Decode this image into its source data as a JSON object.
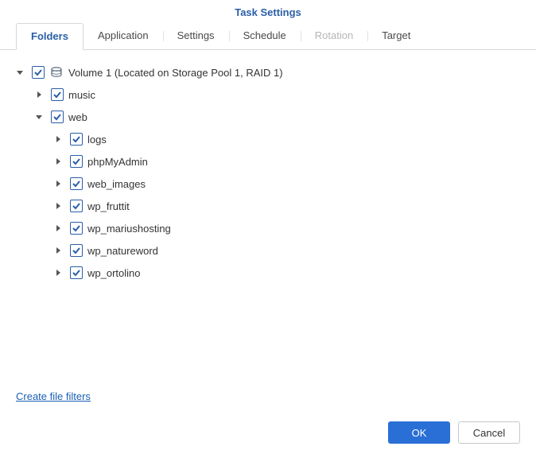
{
  "title": "Task Settings",
  "tabs": [
    "Folders",
    "Application",
    "Settings",
    "Schedule",
    "Rotation",
    "Target"
  ],
  "activeTab": 0,
  "disabledTabs": [
    4
  ],
  "tree": {
    "label": "Volume 1 (Located on Storage Pool 1, RAID 1)",
    "checked": true,
    "expanded": true,
    "children": [
      {
        "label": "music",
        "checked": true,
        "expanded": false
      },
      {
        "label": "web",
        "checked": true,
        "expanded": true,
        "children": [
          {
            "label": "logs",
            "checked": true,
            "expanded": false
          },
          {
            "label": "phpMyAdmin",
            "checked": true,
            "expanded": false
          },
          {
            "label": "web_images",
            "checked": true,
            "expanded": false
          },
          {
            "label": "wp_fruttit",
            "checked": true,
            "expanded": false
          },
          {
            "label": "wp_mariushosting",
            "checked": true,
            "expanded": false
          },
          {
            "label": "wp_natureword",
            "checked": true,
            "expanded": false
          },
          {
            "label": "wp_ortolino",
            "checked": true,
            "expanded": false
          }
        ]
      }
    ]
  },
  "link": "Create file filters",
  "buttons": {
    "ok": "OK",
    "cancel": "Cancel"
  }
}
